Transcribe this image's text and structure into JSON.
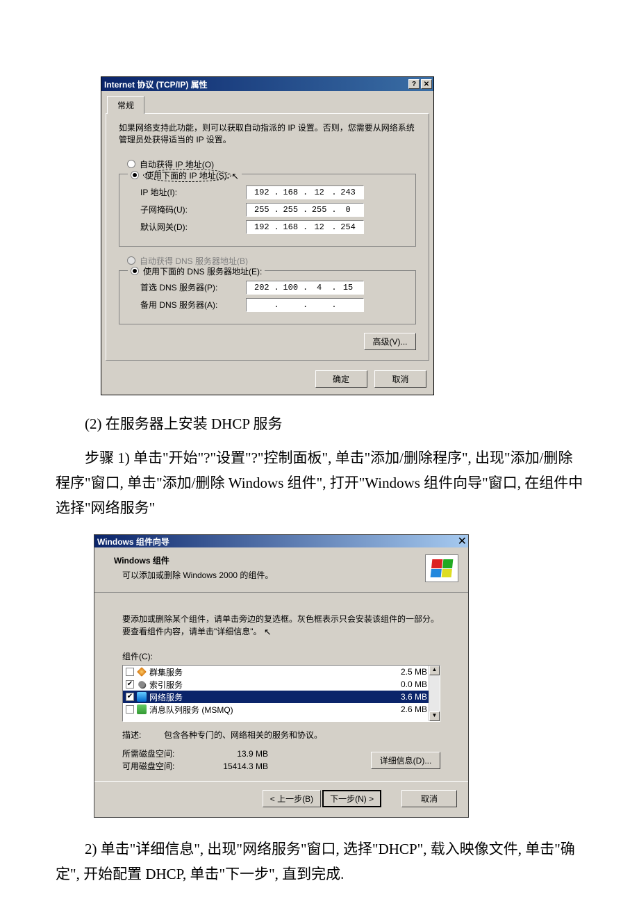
{
  "tcpip": {
    "title": "Internet 协议 (TCP/IP) 属性",
    "help_btn": "?",
    "close_btn": "✕",
    "tab_general": "常规",
    "description": "如果网络支持此功能，则可以获取自动指派的 IP 设置。否则，您需要从网络系统管理员处获得适当的 IP 设置。",
    "radio_auto_ip": "自动获得 IP 地址(O)",
    "radio_manual_ip": "使用下面的 IP 地址(S):",
    "ip_label": "IP 地址(I):",
    "ip_value": [
      "192",
      "168",
      "12",
      "243"
    ],
    "mask_label": "子网掩码(U):",
    "mask_value": [
      "255",
      "255",
      "255",
      "0"
    ],
    "gw_label": "默认网关(D):",
    "gw_value": [
      "192",
      "168",
      "12",
      "254"
    ],
    "radio_auto_dns": "自动获得 DNS 服务器地址(B)",
    "radio_manual_dns": "使用下面的 DNS 服务器地址(E):",
    "dns1_label": "首选 DNS 服务器(P):",
    "dns1_value": [
      "202",
      "100",
      "4",
      "15"
    ],
    "dns2_label": "备用 DNS 服务器(A):",
    "dns2_value": [
      "",
      "",
      "",
      ""
    ],
    "advanced_btn": "高级(V)...",
    "ok_btn": "确定",
    "cancel_btn": "取消"
  },
  "para1": "(2) 在服务器上安装 DHCP 服务",
  "para2": "步骤 1) 单击\"开始\"?\"设置\"?\"控制面板\", 单击\"添加/删除程序\", 出现\"添加/删除程序\"窗口, 单击\"添加/删除 Windows 组件\", 打开\"Windows 组件向导\"窗口, 在组件中选择\"网络服务\"",
  "wizard": {
    "title": "Windows 组件向导",
    "close_btn": "✕",
    "header_title": "Windows 组件",
    "header_sub": "可以添加或删除 Windows 2000 的组件。",
    "instruction": "要添加或删除某个组件，请单击旁边的复选框。灰色框表示只会安装该组件的一部分。要查看组件内容，请单击\"详细信息\"。",
    "components_label": "组件(C):",
    "items": [
      {
        "checked": false,
        "name": "群集服务",
        "size": "2.5 MB"
      },
      {
        "checked": true,
        "name": "索引服务",
        "size": "0.0 MB"
      },
      {
        "checked": true,
        "name": "网络服务",
        "size": "3.6 MB",
        "selected": true
      },
      {
        "checked": false,
        "name": "消息队列服务  (MSMQ)",
        "size": "2.6 MB"
      }
    ],
    "desc_label": "描述:",
    "desc_text": "包含各种专门的、网络相关的服务和协议。",
    "disk_req_label": "所需磁盘空间:",
    "disk_req_val": "13.9 MB",
    "disk_avail_label": "可用磁盘空间:",
    "disk_avail_val": "15414.3 MB",
    "details_btn": "详细信息(D)...",
    "back_btn": "< 上一步(B)",
    "next_btn": "下一步(N) >",
    "cancel_btn2": "取消"
  },
  "para3": "2) 单击\"详细信息\", 出现\"网络服务\"窗口, 选择\"DHCP\", 载入映像文件, 单击\"确定\", 开始配置 DHCP, 单击\"下一步\", 直到完成."
}
